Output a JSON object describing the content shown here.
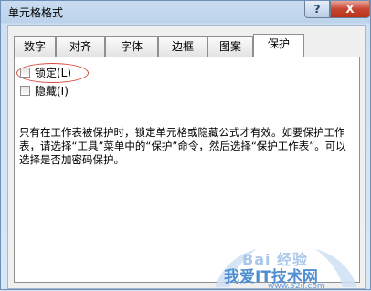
{
  "window": {
    "title": "单元格格式"
  },
  "titlebar_buttons": {
    "help": "?",
    "close": "X"
  },
  "tabs": [
    {
      "label": "数字"
    },
    {
      "label": "对齐"
    },
    {
      "label": "字体"
    },
    {
      "label": "边框"
    },
    {
      "label": "图案"
    },
    {
      "label": "保护",
      "active": true
    }
  ],
  "protection": {
    "locked": {
      "label": "锁定(L)",
      "checked": false
    },
    "hidden": {
      "label": "隐藏(I)",
      "checked": false
    },
    "description": "只有在工作表被保护时，锁定单元格或隐藏公式才有效。如要保护工作表，请选择“工具”菜单中的“保护”命令，然后选择“保护工作表”。可以选择是否加密码保护。"
  },
  "watermark": {
    "line1": "Bai 经验",
    "line2": "我爱IT技术网",
    "line3": "www.52ij.com"
  },
  "colors": {
    "annotation_circle": "#d9483b",
    "close_button": "#c7452f"
  }
}
